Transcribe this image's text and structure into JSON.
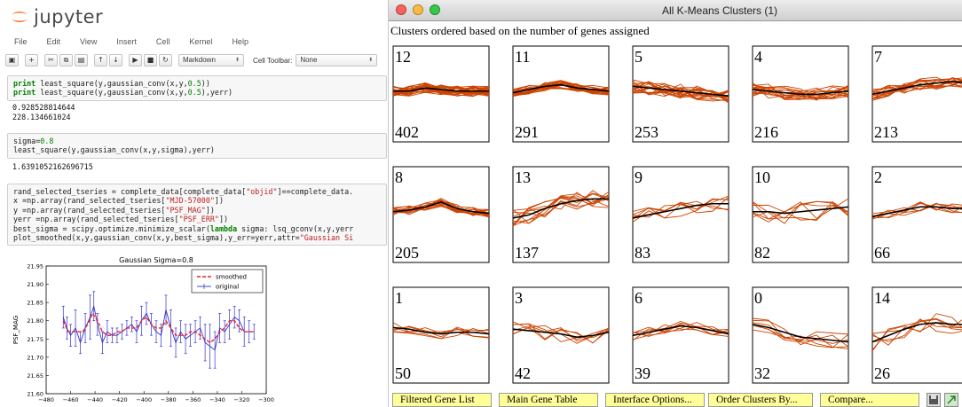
{
  "jupyter": {
    "logo_text": "jupyter",
    "menu": [
      "File",
      "Edit",
      "View",
      "Insert",
      "Cell",
      "Kernel",
      "Help"
    ],
    "toolbar": {
      "icons": [
        "save-icon",
        "add-cell-icon",
        "cut-icon",
        "copy-icon",
        "paste-icon",
        "move-up-icon",
        "move-down-icon",
        "run-icon",
        "stop-icon",
        "restart-icon"
      ],
      "cell_type": "Markdown",
      "cell_toolbar_label": "Cell Toolbar:",
      "cell_toolbar_value": "None"
    },
    "cells": [
      {
        "input": [
          [
            "kw:print",
            " least_square(y,gaussian_conv(x,y,",
            "num:0.5",
            "))"
          ],
          [
            "kw:print",
            " least_square(y,gaussian_conv(x,y,",
            "num:0.5",
            "),yerr)"
          ]
        ],
        "output": [
          "0.928528814644",
          "228.134661024"
        ]
      },
      {
        "input": [
          [
            "sigma=",
            "num:0.8"
          ],
          [
            "least_square(y,gaussian_conv(x,y,sigma),yerr)"
          ]
        ],
        "output": [
          "1.6391052162696715"
        ]
      },
      {
        "input": [
          [
            "rand_selected_tseries = complete_data[complete_data[",
            "str:\"objid\"",
            "]==complete_data."
          ],
          [
            "x =np.array(rand_selected_tseries[",
            "str:\"MJD-57000\"",
            "])"
          ],
          [
            "y =np.array(rand_selected_tseries[",
            "str:\"PSF_MAG\"",
            "])"
          ],
          [
            "yerr =np.array(rand_selected_tseries[",
            "str:\"PSF_ERR\"",
            "])"
          ],
          [
            "best_sigma = scipy.optimize.minimize_scalar(",
            "kw:lambda",
            " sigma: lsq_gconv(x,y,yerr"
          ],
          [
            "plot_smoothed(x,y,gaussian_conv(x,y,best_sigma),y_err=yerr,attr=",
            "str:\"Gaussian Si"
          ]
        ],
        "output": []
      }
    ],
    "plot": {
      "colors": {
        "original": "#3333cc",
        "smoothed": "#ee2222"
      },
      "chart_data": {
        "type": "line",
        "title": "Gaussian Sigma=0.8",
        "xlabel": "",
        "ylabel": "PSF_MAG",
        "xlim": [
          -480,
          -300
        ],
        "ylim": [
          21.6,
          21.95
        ],
        "xticks": [
          "-480",
          "-460",
          "-440",
          "-420",
          "-400",
          "-380",
          "-360",
          "-340",
          "-320",
          "-300"
        ],
        "yticks": [
          "21.60",
          "21.65",
          "21.70",
          "21.75",
          "21.80",
          "21.85",
          "21.90",
          "21.95"
        ],
        "legend": [
          "smoothed",
          "original"
        ],
        "legend_position": "top-right",
        "series": [
          {
            "name": "original",
            "x": [
              -466,
              -463,
              -460,
              -456,
              -452,
              -448,
              -444,
              -441,
              -438,
              -434,
              -430,
              -426,
              -422,
              -418,
              -414,
              -410,
              -406,
              -402,
              -398,
              -394,
              -390,
              -386,
              -382,
              -378,
              -374,
              -370,
              -366,
              -362,
              -358,
              -354,
              -350,
              -346,
              -342,
              -338,
              -334,
              -330,
              -326,
              -322,
              -318,
              -314,
              -310
            ],
            "y": [
              21.81,
              21.78,
              21.76,
              21.78,
              21.74,
              21.78,
              21.81,
              21.84,
              21.79,
              21.74,
              21.77,
              21.76,
              21.76,
              21.77,
              21.78,
              21.79,
              21.77,
              21.8,
              21.82,
              21.79,
              21.77,
              21.76,
              21.83,
              21.78,
              21.74,
              21.77,
              21.75,
              21.76,
              21.77,
              21.78,
              21.74,
              21.73,
              21.72,
              21.78,
              21.77,
              21.79,
              21.81,
              21.8,
              21.77,
              21.77,
              21.77
            ],
            "yerr": [
              0.03,
              0.03,
              0.03,
              0.05,
              0.03,
              0.04,
              0.06,
              0.04,
              0.03,
              0.03,
              0.03,
              0.02,
              0.02,
              0.02,
              0.02,
              0.02,
              0.03,
              0.04,
              0.03,
              0.03,
              0.03,
              0.03,
              0.04,
              0.05,
              0.04,
              0.03,
              0.04,
              0.03,
              0.03,
              0.03,
              0.05,
              0.06,
              0.05,
              0.04,
              0.03,
              0.04,
              0.03,
              0.03,
              0.04,
              0.03,
              0.02
            ]
          },
          {
            "name": "smoothed",
            "x": [
              -466,
              -462,
              -458,
              -454,
              -450,
              -446,
              -442,
              -438,
              -434,
              -430,
              -426,
              -422,
              -418,
              -414,
              -410,
              -406,
              -402,
              -398,
              -394,
              -390,
              -386,
              -382,
              -378,
              -374,
              -370,
              -366,
              -362,
              -358,
              -354,
              -350,
              -346,
              -342,
              -338,
              -334,
              -330,
              -326,
              -322,
              -318,
              -314,
              -310
            ],
            "y": [
              21.8,
              21.77,
              21.77,
              21.77,
              21.77,
              21.79,
              21.82,
              21.8,
              21.77,
              21.76,
              21.76,
              21.77,
              21.77,
              21.78,
              21.78,
              21.78,
              21.8,
              21.81,
              21.79,
              21.78,
              21.78,
              21.8,
              21.78,
              21.76,
              21.76,
              21.76,
              21.77,
              21.77,
              21.76,
              21.75,
              21.74,
              21.75,
              21.77,
              21.78,
              21.8,
              21.8,
              21.78,
              21.77,
              21.77,
              21.77
            ]
          }
        ]
      }
    }
  },
  "kmeans": {
    "window_title": "All K-Means Clusters (1)",
    "subtitle": "Clusters ordered based on the number of genes assigned",
    "colors": {
      "gene_lines": "#cc4400",
      "mean_line": "#000000"
    },
    "clusters": [
      {
        "id": "12",
        "count": "402",
        "shape": [
          0,
          0,
          0.2,
          0.1,
          0,
          0,
          0
        ],
        "spread": 0.6
      },
      {
        "id": "11",
        "count": "291",
        "shape": [
          -0.1,
          0.1,
          0.3,
          0.4,
          0.2,
          0.1,
          0
        ],
        "spread": 0.5
      },
      {
        "id": "5",
        "count": "253",
        "shape": [
          0.3,
          0.2,
          0.1,
          0,
          -0.1,
          -0.2,
          -0.3
        ],
        "spread": 0.8
      },
      {
        "id": "4",
        "count": "216",
        "shape": [
          0.1,
          0,
          -0.1,
          -0.2,
          -0.2,
          -0.1,
          0
        ],
        "spread": 0.8
      },
      {
        "id": "7",
        "count": "213",
        "shape": [
          -0.2,
          0,
          0.2,
          0.4,
          0.5,
          0.6,
          0.5
        ],
        "spread": 0.7
      },
      {
        "id": "8",
        "count": "205",
        "shape": [
          0,
          0.1,
          0.3,
          0.6,
          0.2,
          0,
          -0.1
        ],
        "spread": 0.5
      },
      {
        "id": "13",
        "count": "137",
        "shape": [
          -0.4,
          -0.2,
          0.2,
          0.5,
          0.7,
          0.8,
          0.8
        ],
        "spread": 1.0
      },
      {
        "id": "9",
        "count": "83",
        "shape": [
          -0.4,
          -0.2,
          0,
          0.2,
          0.4,
          0.5,
          0.5
        ],
        "spread": 0.9
      },
      {
        "id": "10",
        "count": "82",
        "shape": [
          0,
          0,
          -0.1,
          0,
          0.1,
          0.2,
          0.3
        ],
        "spread": 1.2
      },
      {
        "id": "2",
        "count": "66",
        "shape": [
          -0.3,
          -0.1,
          0.1,
          0.3,
          0.3,
          0.2,
          0.2
        ],
        "spread": 0.6
      },
      {
        "id": "1",
        "count": "50",
        "shape": [
          0.3,
          0.2,
          0,
          -0.1,
          0,
          0,
          -0.1
        ],
        "spread": 0.6
      },
      {
        "id": "3",
        "count": "42",
        "shape": [
          0.2,
          0.1,
          0,
          -0.1,
          -0.3,
          -0.2,
          0
        ],
        "spread": 0.9
      },
      {
        "id": "6",
        "count": "39",
        "shape": [
          -0.2,
          0,
          0.2,
          0.4,
          0.3,
          0.1,
          -0.1
        ],
        "spread": 0.6
      },
      {
        "id": "0",
        "count": "32",
        "shape": [
          0.5,
          0.3,
          0,
          -0.3,
          -0.4,
          -0.5,
          -0.6
        ],
        "spread": 0.9
      },
      {
        "id": "14",
        "count": "26",
        "shape": [
          -0.6,
          -0.2,
          0.2,
          0.5,
          0.6,
          0.5,
          0.5
        ],
        "spread": 1.1
      }
    ],
    "buttons": [
      "Filtered Gene List",
      "Main Gene Table",
      "Interface Options...",
      "Order Clusters By...",
      "Compare..."
    ],
    "icons": [
      "save-icon",
      "export-icon"
    ]
  }
}
